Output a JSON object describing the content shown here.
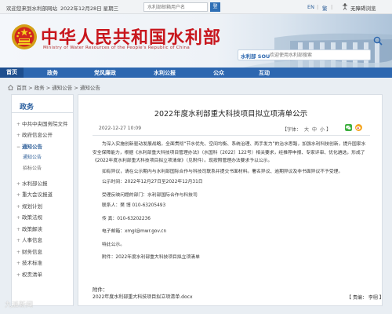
{
  "topbar": {
    "welcome": "欢迎您来到水利部网站",
    "date": "2022年12月28日 星期三",
    "login_placeholder": "水利部邮箱用户名",
    "login_button": "登",
    "lang_en": "EN",
    "lang_tc": "繁",
    "accessibility": "无障碍浏览"
  },
  "banner": {
    "title": "中华人民共和国水利部",
    "subtitle": "Ministry of Water Resources of the People's Republic of China",
    "search_brand": "水利部 SOU",
    "search_placeholder": "欢迎使用水利部搜索"
  },
  "nav": {
    "items": [
      "首页",
      "政务",
      "党风廉政",
      "水利公报",
      "公众",
      "互动"
    ]
  },
  "breadcrumb": {
    "home": "首页",
    "level1": "政务",
    "level2": "通知公告",
    "level3": "通知公告",
    "separator": ">"
  },
  "sidebar": {
    "title": "政务",
    "items": [
      {
        "label": "中共中央国务院文件"
      },
      {
        "label": "政府信息公开"
      },
      {
        "label": "通知公告"
      },
      {
        "label": "通知公告"
      },
      {
        "label": "招标公告"
      },
      {
        "label": "水利部公报"
      },
      {
        "label": "重大会议报道"
      },
      {
        "label": "规划计划"
      },
      {
        "label": "政策法规"
      },
      {
        "label": "政策解读"
      },
      {
        "label": "人事信息"
      },
      {
        "label": "财务信息"
      },
      {
        "label": "技术标准"
      },
      {
        "label": "权责清单"
      }
    ]
  },
  "article": {
    "title": "2022年度水利部重大科技项目拟立项清单公示",
    "date": "2022-12-27 10:09",
    "font_label": "【字体：",
    "font_large": "大",
    "font_medium": "中",
    "font_small": "小",
    "font_end": "】",
    "para1": "为深入实施创新驱动发展战略，全面贯彻“节水优先、空间均衡、系统治理、两手发力”的治水思路，加强水利科技创新，提升国家水安全保障能力，根据《水利部重大科技项目管理办法》（水国科〔2022〕122号）相关要求，经推荐申报、专家评审、优化遴选，形成了《2022年度水利部重大科技项目拟立项清单》（见附件）。现按照管理办法要求予以公示。",
    "para2": "如有异议，请在公示期内与水利部国际合作与科技司联系并提交书面材料。署名异议、逾期异议及非书面异议不予受理。",
    "period": "公示时间：2022年12月27日至2022年12月31日",
    "dept": "受理反映问题的部门：水利部国际合作与科技司",
    "contact": "联系人：樊  博  010-63205493",
    "fax": "传    真：010-63202236",
    "email": "电子邮箱：xmgl@mwr.gov.cn",
    "special": "特此公示。",
    "attach_inline": "附件：2022年度水利部重大科技项目拟立项清单",
    "attach_label": "附件：",
    "attach_file": "2022年度水利部重大科技项目拟立项清单.docx",
    "editor": "【  责编：  李栩  】"
  },
  "watermark": "九派新闻",
  "colors": {
    "brand_red": "#c8161d",
    "nav_blue": "#2d67b0",
    "link_blue": "#2e5f99"
  }
}
